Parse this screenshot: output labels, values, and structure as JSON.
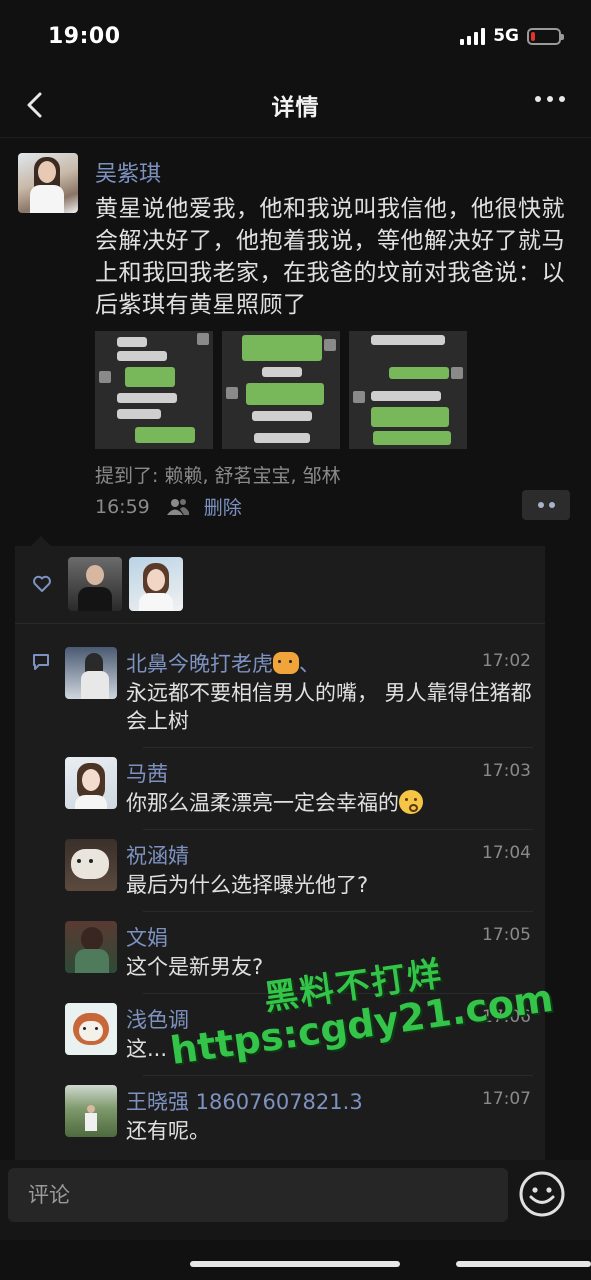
{
  "status_bar": {
    "time": "19:00",
    "network": "5G",
    "battery_level": 0.15,
    "battery_color": "#e5322d"
  },
  "nav": {
    "title": "详情"
  },
  "post": {
    "author": "吴紫琪",
    "text": "黄星说他爱我，他和我说叫我信他，他很快就会解决好了，他抱着我说，等他解决好了就马上和我回我老家，在我爸的坟前对我爸说：以后紫琪有黄星照顾了",
    "mentions": "提到了: 赖赖, 舒茗宝宝, 邹林",
    "time": "16:59",
    "delete_label": "删除"
  },
  "comments": [
    {
      "name": "北鼻今晚打老虎",
      "name_suffix": "、",
      "time": "17:02",
      "text": "永远都不要相信男人的嘴， 男人靠得住猪都会上树"
    },
    {
      "name": "马茜",
      "time": "17:03",
      "text": "你那么温柔漂亮一定会幸福的"
    },
    {
      "name": "祝涵婧",
      "time": "17:04",
      "text": "最后为什么选择曝光他了?"
    },
    {
      "name": "文娟",
      "time": "17:05",
      "text": "这个是新男友?"
    },
    {
      "name": "浅色调",
      "time": "17:06",
      "text": "这..."
    },
    {
      "name": "王晓强 18607607821.3",
      "time": "17:07",
      "text": "还有呢。"
    }
  ],
  "watermark": {
    "line1": "黑料不打烊",
    "line2": "https:cgdy21.com"
  },
  "input": {
    "placeholder": "评论"
  },
  "colors": {
    "background": "#111111",
    "link": "#7d92c0",
    "watermark": "#35c44a"
  }
}
